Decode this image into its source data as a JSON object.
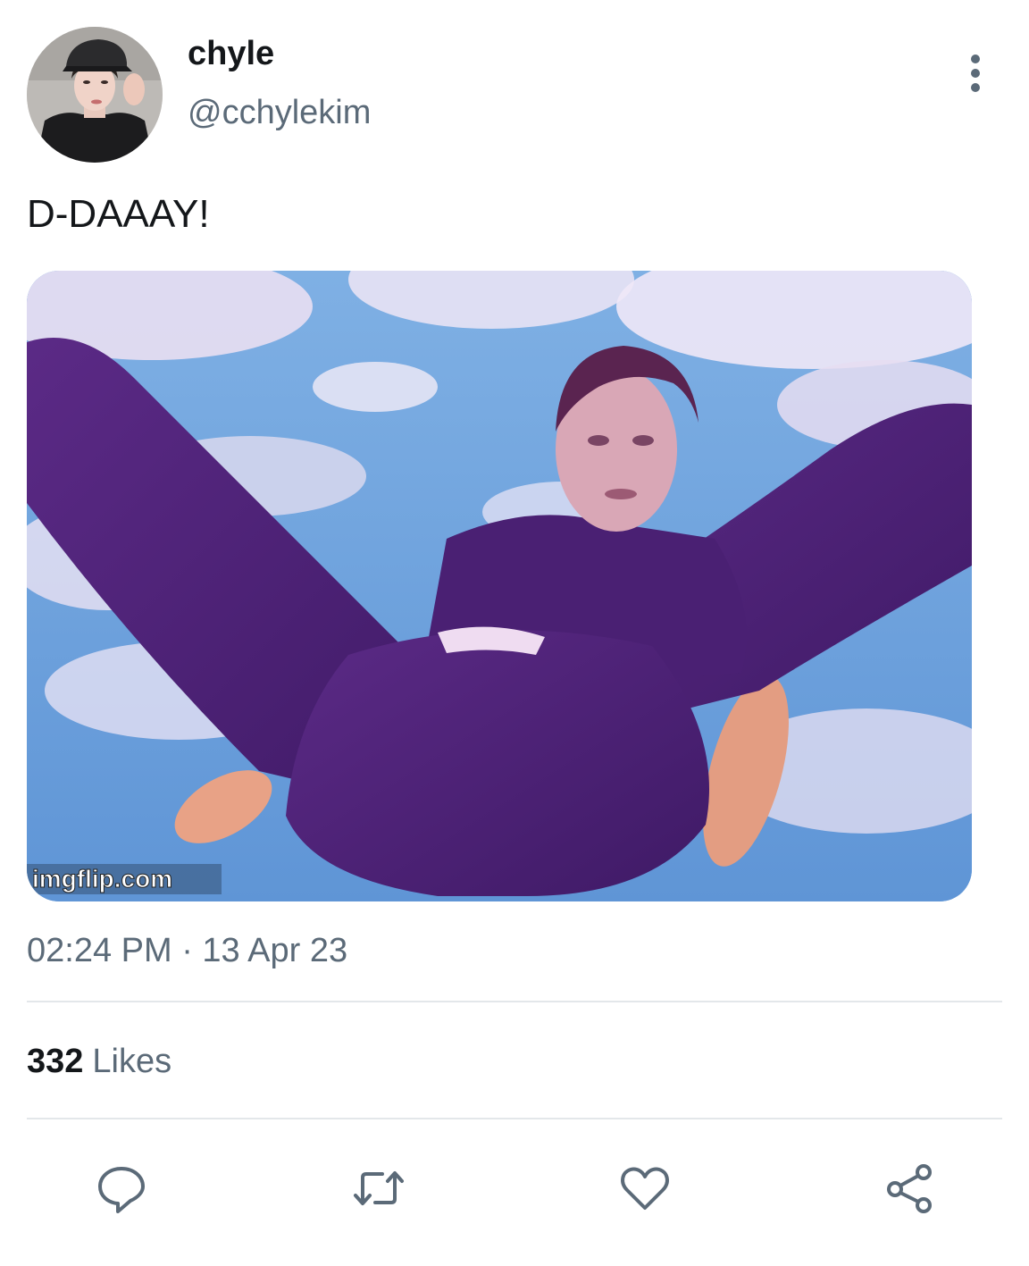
{
  "tweet": {
    "author": {
      "display_name": "chyle",
      "handle": "@cchylekim"
    },
    "text": "D-DAAAY!",
    "media": {
      "watermark": "imgflip.com"
    },
    "timestamp": "02:24 PM · 13 Apr 23",
    "likes": {
      "count": "332",
      "label": "Likes"
    }
  },
  "icons": {
    "more": "more-vertical-icon",
    "reply": "reply-icon",
    "retweet": "retweet-icon",
    "like": "heart-icon",
    "share": "share-icon"
  },
  "colors": {
    "text_primary": "#14171a",
    "text_secondary": "#5b6a78",
    "icon": "#5b6a78",
    "divider": "#e3e7ea"
  }
}
